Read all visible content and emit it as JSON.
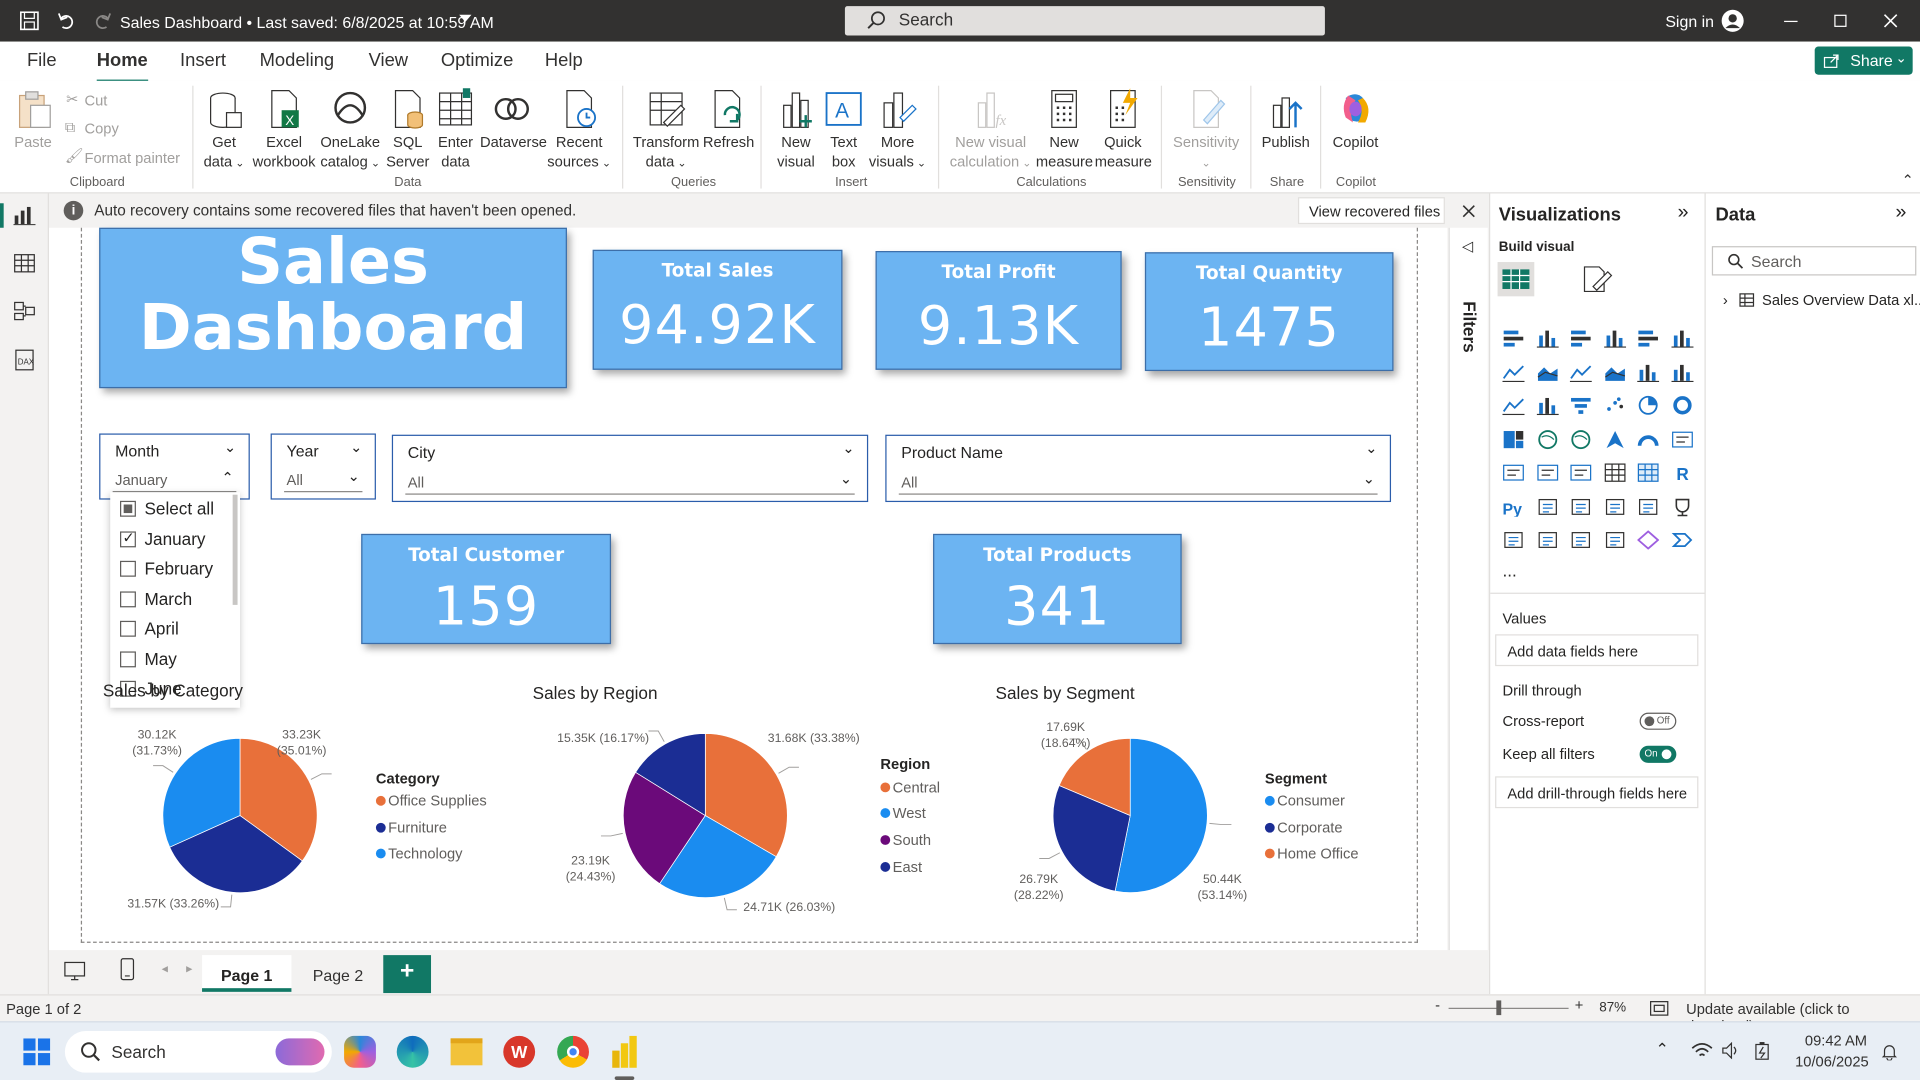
{
  "window": {
    "title": "Sales Dashboard • Last saved: 6/8/2025 at 10:59 AM",
    "search_placeholder": "Search",
    "sign_in": "Sign in"
  },
  "menu": {
    "tabs": [
      "File",
      "Home",
      "Insert",
      "Modeling",
      "View",
      "Optimize",
      "Help"
    ],
    "active": "Home",
    "share": "Share"
  },
  "ribbon": {
    "clipboard": {
      "paste": "Paste",
      "cut": "Cut",
      "copy": "Copy",
      "format_painter": "Format painter",
      "group": "Clipboard"
    },
    "data": {
      "get_data": [
        "Get",
        "data"
      ],
      "excel": [
        "Excel",
        "workbook"
      ],
      "onelake": [
        "OneLake",
        "catalog"
      ],
      "sql": [
        "SQL",
        "Server"
      ],
      "enter": [
        "Enter",
        "data"
      ],
      "dataverse": "Dataverse",
      "recent": [
        "Recent",
        "sources"
      ],
      "group": "Data"
    },
    "queries": {
      "transform": [
        "Transform",
        "data"
      ],
      "refresh": "Refresh",
      "group": "Queries"
    },
    "insert": {
      "new_visual": [
        "New",
        "visual"
      ],
      "text_box": [
        "Text",
        "box"
      ],
      "more_visuals": [
        "More",
        "visuals"
      ],
      "group": "Insert"
    },
    "calculations": {
      "new_visual_calc": [
        "New visual",
        "calculation"
      ],
      "new_measure": [
        "New",
        "measure"
      ],
      "quick_measure": [
        "Quick",
        "measure"
      ],
      "group": "Calculations"
    },
    "sensitivity": {
      "label": "Sensitivity",
      "group": "Sensitivity"
    },
    "share": {
      "publish": "Publish",
      "group": "Share"
    },
    "copilot": {
      "label": "Copilot",
      "group": "Copilot"
    }
  },
  "notice": {
    "text": "Auto recovery contains some recovered files that haven't been opened.",
    "button": "View recovered files"
  },
  "dashboard": {
    "title": [
      "Sales",
      "Dashboard"
    ],
    "kpis": [
      {
        "label": "Total Sales",
        "value": "94.92K"
      },
      {
        "label": "Total Profit",
        "value": "9.13K"
      },
      {
        "label": "Total Quantity",
        "value": "1475"
      },
      {
        "label": "Total Customer",
        "value": "159"
      },
      {
        "label": "Total Products",
        "value": "341"
      }
    ],
    "slicers": {
      "month": {
        "label": "Month",
        "value": "January",
        "options": [
          "Select all",
          "January",
          "February",
          "March",
          "April",
          "May",
          "June"
        ],
        "checked": "January"
      },
      "year": {
        "label": "Year",
        "value": "All"
      },
      "city": {
        "label": "City",
        "value": "All"
      },
      "product": {
        "label": "Product Name",
        "value": "All"
      }
    }
  },
  "chart_data": [
    {
      "type": "pie",
      "title": "Sales by Category",
      "legend_title": "Category",
      "categories": [
        "Office Supplies",
        "Furniture",
        "Technology"
      ],
      "values": [
        33.23,
        31.57,
        30.12
      ],
      "labels": [
        [
          "33.23K",
          "(35.01%)"
        ],
        [
          "31.57K (33.26%)"
        ],
        [
          "30.12K",
          "(31.73%)"
        ]
      ],
      "colors": [
        "#e8703a",
        "#1b2d94",
        "#1a8cf0"
      ]
    },
    {
      "type": "pie",
      "title": "Sales by Region",
      "legend_title": "Region",
      "categories": [
        "Central",
        "West",
        "South",
        "East"
      ],
      "values": [
        31.68,
        24.71,
        23.19,
        15.35
      ],
      "labels": [
        [
          "31.68K (33.38%)"
        ],
        [
          "24.71K (26.03%)"
        ],
        [
          "23.19K",
          "(24.43%)"
        ],
        [
          "15.35K (16.17%)"
        ]
      ],
      "colors": [
        "#e8703a",
        "#1a8cf0",
        "#6b0a7a",
        "#1b2d94"
      ]
    },
    {
      "type": "pie",
      "title": "Sales by Segment",
      "legend_title": "Segment",
      "categories": [
        "Consumer",
        "Corporate",
        "Home Office"
      ],
      "values": [
        50.44,
        26.79,
        17.69
      ],
      "labels": [
        [
          "50.44K",
          "(53.14%)"
        ],
        [
          "26.79K",
          "(28.22%)"
        ],
        [
          "17.69K",
          "(18.64%)"
        ]
      ],
      "colors": [
        "#1a8cf0",
        "#1b2d94",
        "#e8703a"
      ]
    }
  ],
  "filters": {
    "label": "Filters"
  },
  "visualizations": {
    "title": "Visualizations",
    "build_visual": "Build visual",
    "values": "Values",
    "add_fields": "Add data fields here",
    "drill_through": "Drill through",
    "cross_report": "Cross-report",
    "cross_report_state": "Off",
    "keep_filters": "Keep all filters",
    "keep_filters_state": "On",
    "add_drill": "Add drill-through fields here",
    "more": "..."
  },
  "data_pane": {
    "title": "Data",
    "search_placeholder": "Search",
    "table": "Sales Overview Data xl..."
  },
  "pages": {
    "tabs": [
      "Page 1",
      "Page 2"
    ],
    "add": "+"
  },
  "status": {
    "page": "Page 1 of 2",
    "zoom": "87%",
    "update": "Update available (click to download)"
  },
  "taskbar": {
    "search": "Search",
    "time": "09:42 AM",
    "date": "10/06/2025"
  }
}
